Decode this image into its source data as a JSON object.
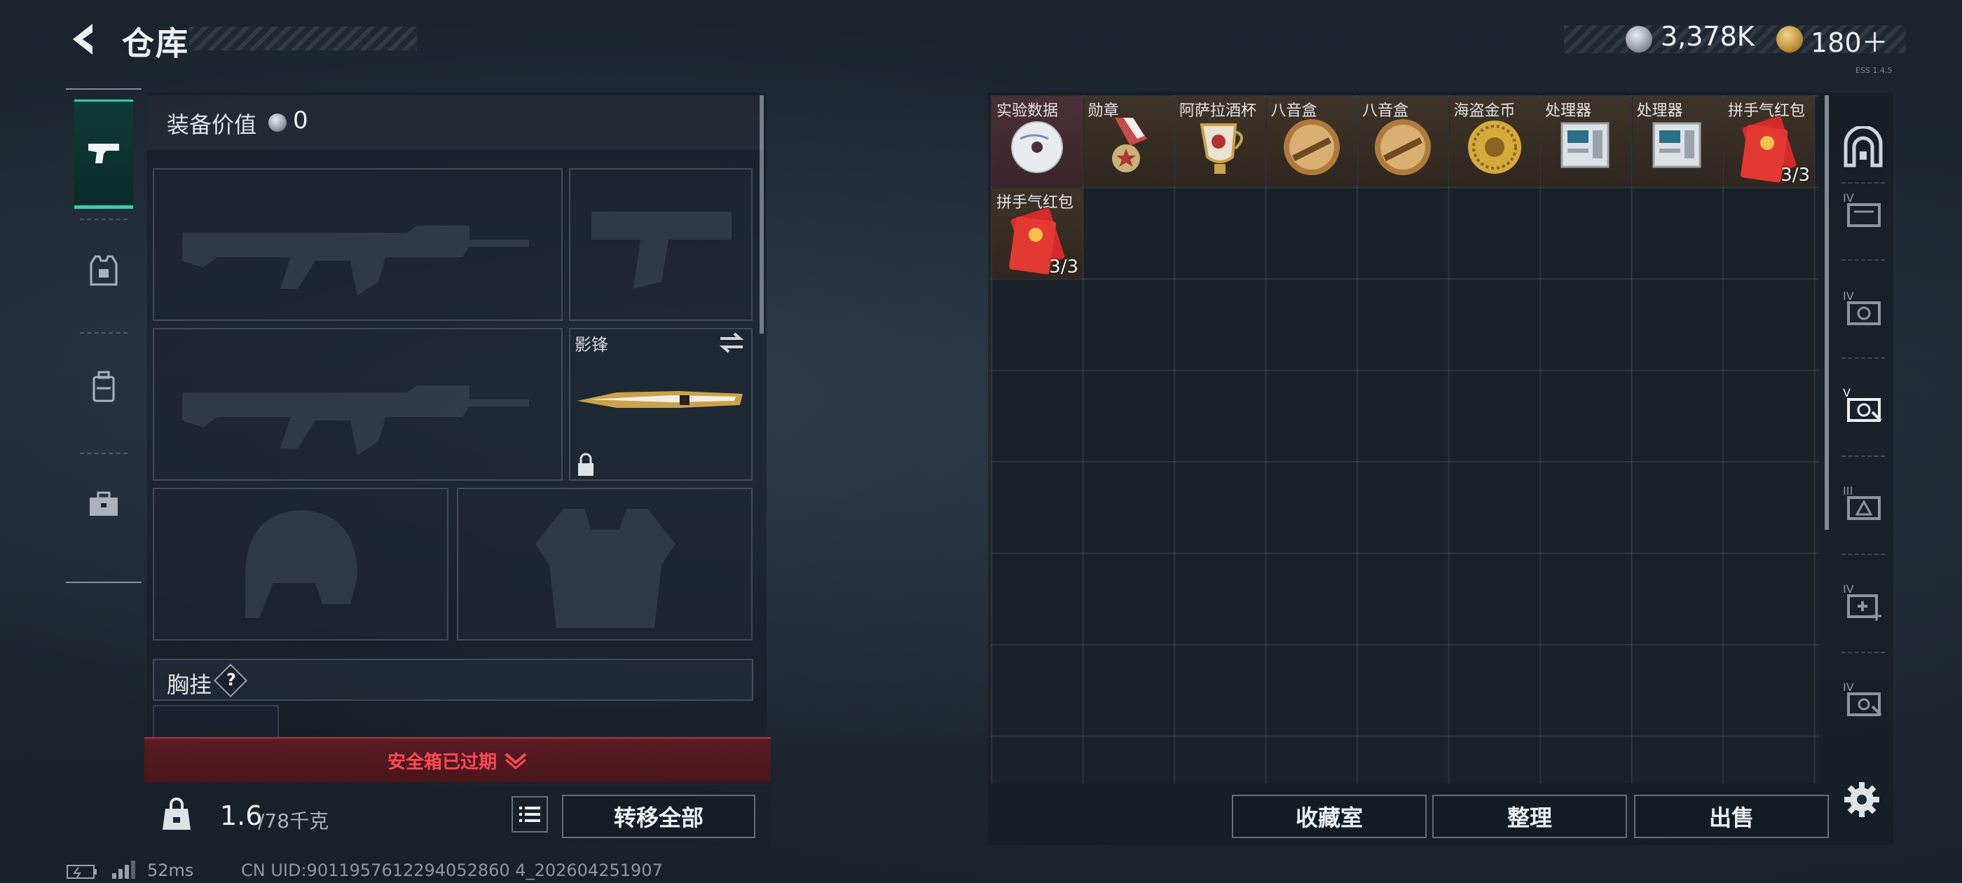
{
  "header": {
    "title": "仓库",
    "currency_silver": "3,378K",
    "currency_gold": "180＋",
    "tiny_text": "ESS 1.4.5"
  },
  "equipment": {
    "value_label": "装备价值",
    "value_num": "0",
    "melee_label": "影锋",
    "chest_rig_label": "胸挂",
    "help_glyph": "?",
    "expired_text": "安全箱已过期",
    "weight_current": "1.6",
    "weight_max": "/78千克",
    "transfer_all": "转移全部"
  },
  "storage": {
    "items": [
      {
        "name": "实验数据",
        "count": "",
        "rare": true,
        "icon": "disc-icon"
      },
      {
        "name": "勋章",
        "count": "",
        "rare": false,
        "icon": "medal-icon"
      },
      {
        "name": "阿萨拉酒杯",
        "count": "",
        "rare": false,
        "icon": "goblet-icon"
      },
      {
        "name": "八音盒",
        "count": "",
        "rare": false,
        "icon": "music-box-icon"
      },
      {
        "name": "八音盒",
        "count": "",
        "rare": false,
        "icon": "music-box-icon"
      },
      {
        "name": "海盗金币",
        "count": "",
        "rare": false,
        "icon": "gold-coin-icon"
      },
      {
        "name": "处理器",
        "count": "",
        "rare": false,
        "icon": "processor-icon"
      },
      {
        "name": "处理器",
        "count": "",
        "rare": false,
        "icon": "processor-icon"
      },
      {
        "name": "拼手气红包",
        "count": "3/3",
        "rare": false,
        "icon": "red-envelope-icon"
      },
      {
        "name": "拼手气红包",
        "count": "3/3",
        "rare": false,
        "icon": "red-envelope-icon"
      }
    ],
    "collection_btn": "收藏室",
    "sort_btn": "整理",
    "sell_btn": "出售"
  },
  "right_sidebar": {
    "tier_labels": [
      "IV",
      "IV",
      "V",
      "III",
      "IV",
      "IV"
    ]
  },
  "status": {
    "ping": "52ms",
    "uid": "CN UID:9011957612294052860 4_202604251907"
  },
  "colors": {
    "accent": "#2fd1a8",
    "danger": "#ff4a55",
    "item_bg": "#3f3328"
  }
}
